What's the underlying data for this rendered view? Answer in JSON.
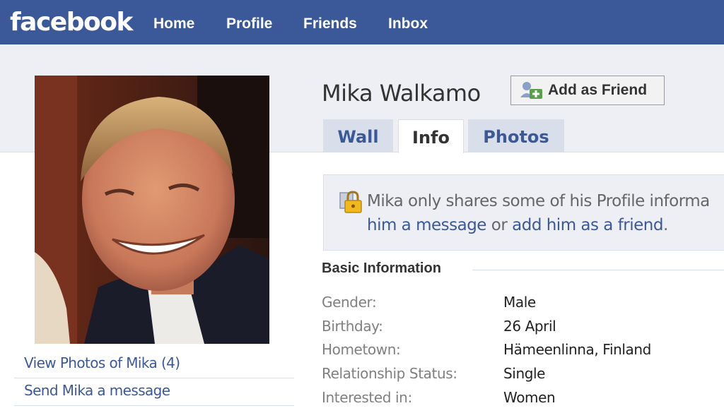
{
  "header": {
    "logo": "facebook",
    "nav": [
      "Home",
      "Profile",
      "Friends",
      "Inbox"
    ],
    "brand_color": "#3b5998"
  },
  "profile": {
    "name": "Mika Walkamo",
    "add_friend_label": "Add as Friend",
    "add_friend_icon": "add-friend-icon",
    "left_links": [
      "View Photos of Mika (4)",
      "Send Mika a message"
    ]
  },
  "tabs": [
    {
      "label": "Wall",
      "active": false
    },
    {
      "label": "Info",
      "active": true
    },
    {
      "label": "Photos",
      "active": false
    }
  ],
  "notice": {
    "icon": "lock-icon",
    "text_start": "Mika only shares some of his Profile informa",
    "link_message": "him a message",
    "connector": " or ",
    "link_friend": "add him as a friend",
    "period": "."
  },
  "basic_info": {
    "title": "Basic Information",
    "rows": [
      {
        "label": "Gender:",
        "value": "Male"
      },
      {
        "label": "Birthday:",
        "value": "26 April"
      },
      {
        "label": "Hometown:",
        "value": "Hämeenlinna, Finland"
      },
      {
        "label": "Relationship Status:",
        "value": "Single"
      },
      {
        "label": "Interested in:",
        "value": "Women"
      }
    ]
  }
}
